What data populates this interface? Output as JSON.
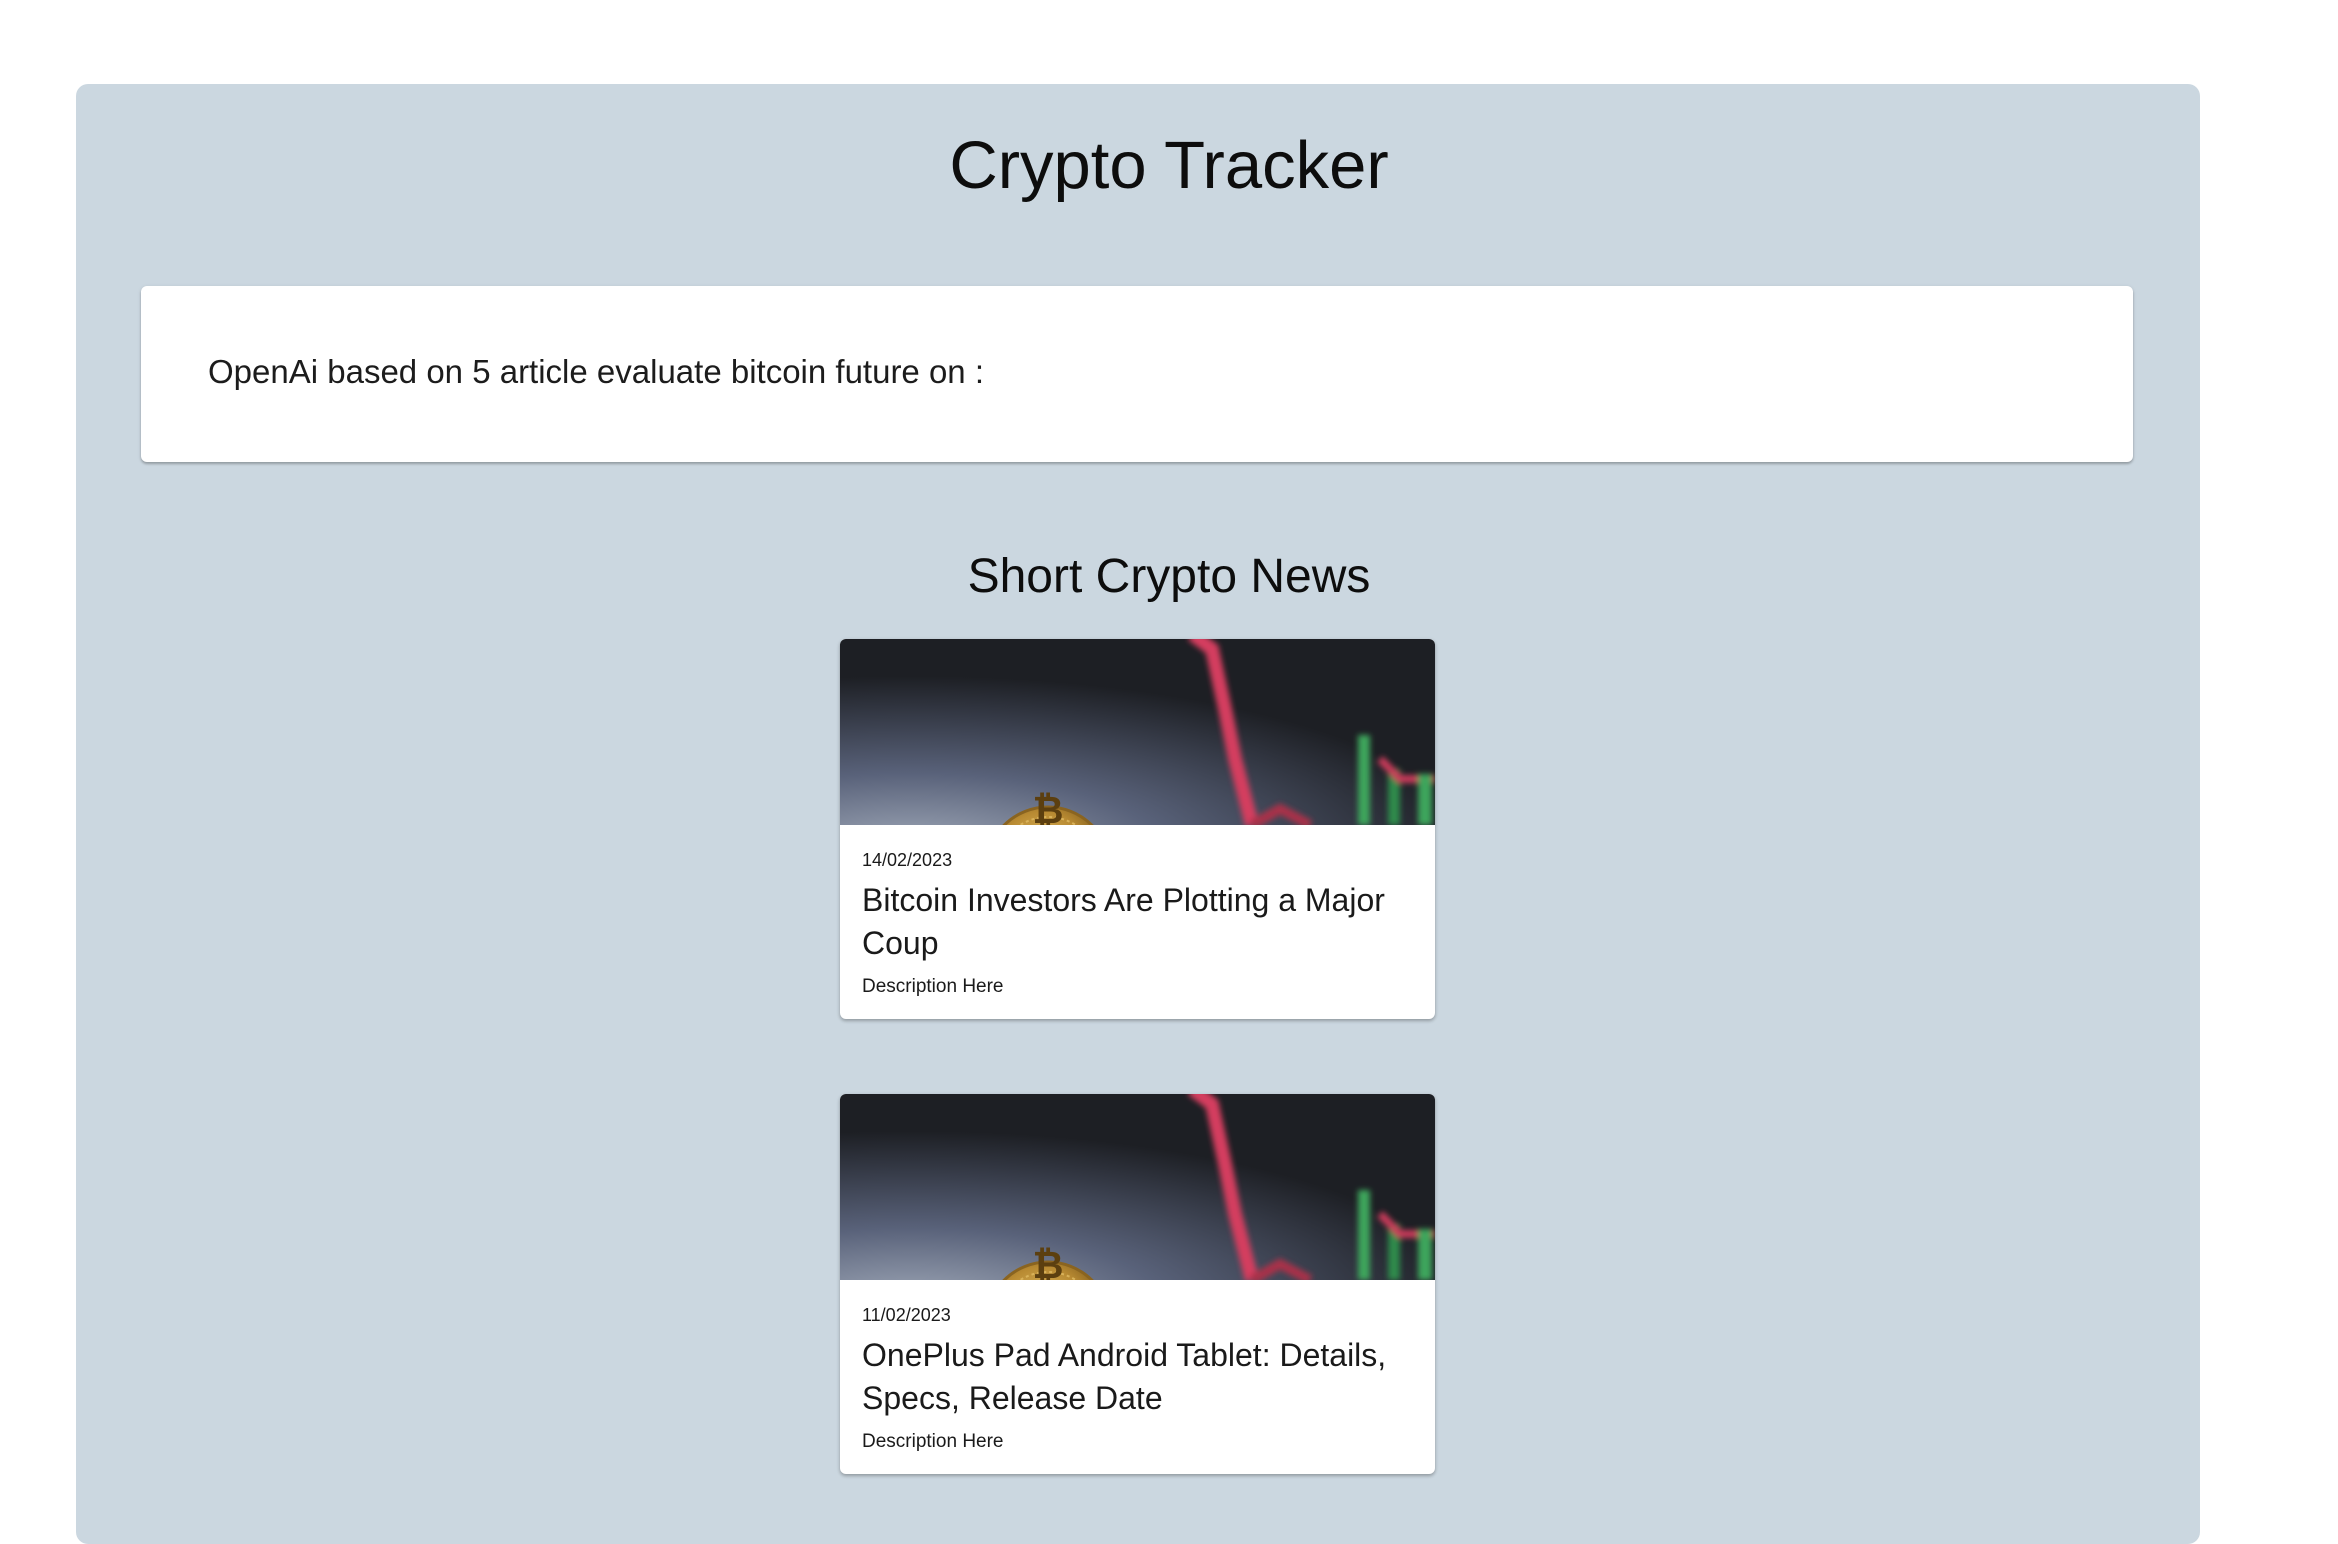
{
  "app": {
    "title": "Crypto Tracker"
  },
  "ai_summary": {
    "text": "OpenAi based on 5 article evaluate bitcoin future on :"
  },
  "news": {
    "heading": "Short Crypto News",
    "items": [
      {
        "date": "14/02/2023",
        "title": "Bitcoin Investors Are Plotting a Major Coup",
        "description": "Description Here",
        "image_icon": "bitcoin-chart-image"
      },
      {
        "date": "11/02/2023",
        "title": "OnePlus Pad Android Tablet: Details, Specs, Release Date",
        "description": "Description Here",
        "image_icon": "bitcoin-chart-image"
      }
    ]
  },
  "colors": {
    "panel_background": "#cbd7e0",
    "card_background": "#ffffff",
    "text": "#111111"
  }
}
